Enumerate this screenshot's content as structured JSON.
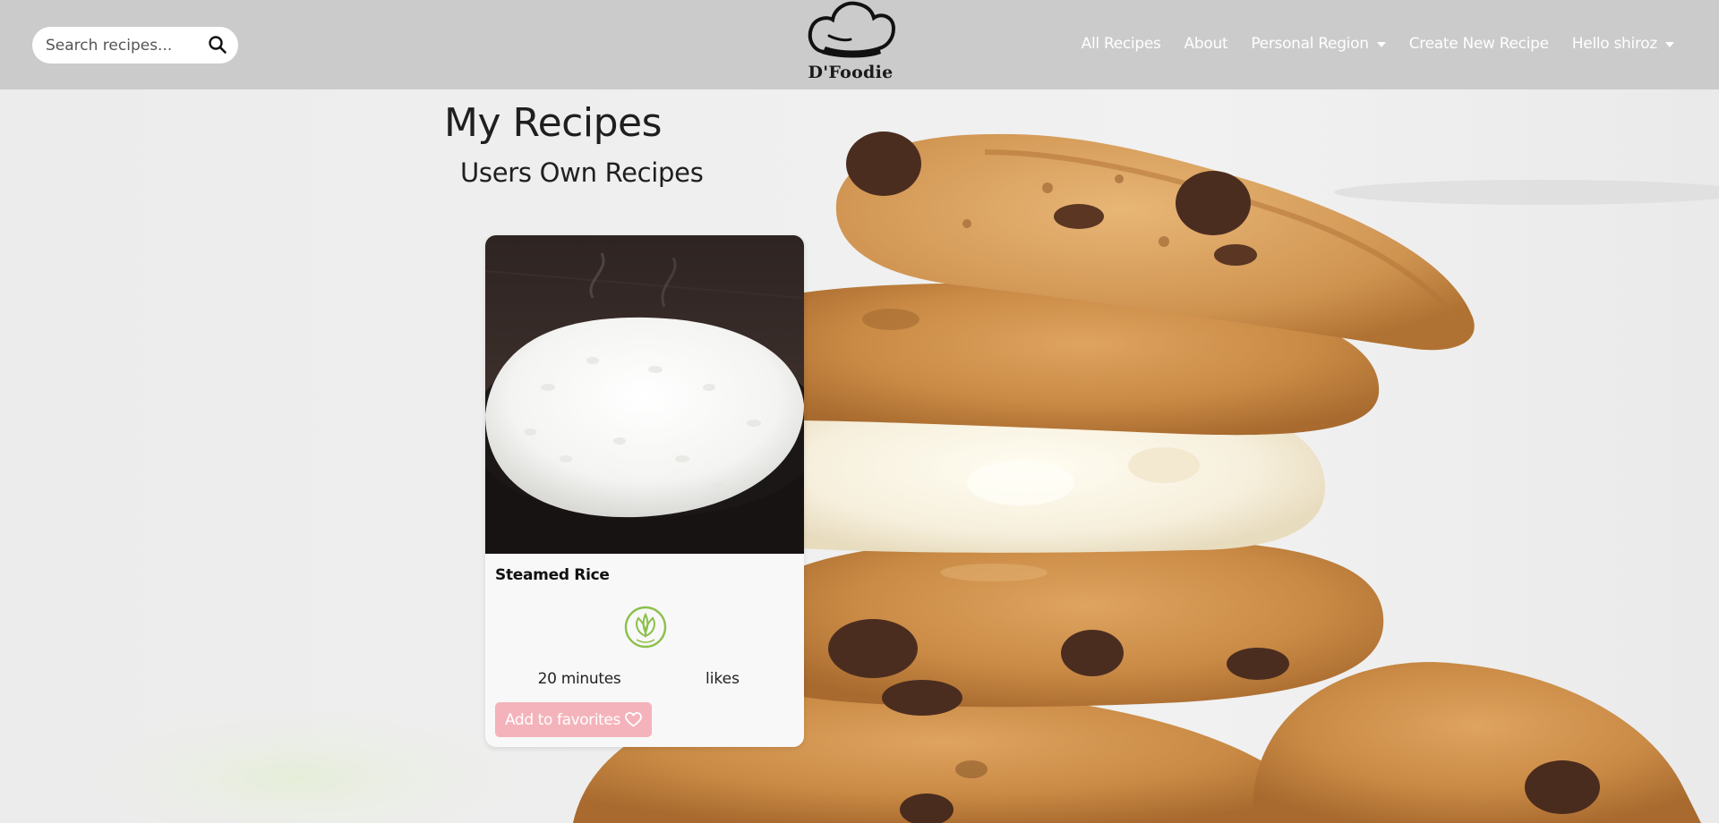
{
  "navbar": {
    "search": {
      "placeholder": "Search recipes...",
      "icon": "search-icon"
    },
    "logo": {
      "text": "D'Foodie",
      "icon": "chef-hat-icon"
    },
    "links": {
      "all_recipes": "All Recipes",
      "about": "About",
      "personal_region": "Personal Region",
      "create_new_recipe": "Create New Recipe",
      "user_greeting": "Hello shiroz"
    }
  },
  "main": {
    "title": "My Recipes",
    "subtitle": "Users Own Recipes"
  },
  "recipe_card": {
    "name": "Steamed Rice",
    "image": "steamed-rice-bowl",
    "badge": "vegan-icon",
    "time": "20 minutes",
    "likes": "likes",
    "favorite_button": "Add to favorites",
    "favorite_icon": "heart-icon"
  },
  "colors": {
    "navbar_bg": "#c8c8c8",
    "favorite_button": "#f4b3bb",
    "vegan_badge": "#8cc04b",
    "page_bg": "#ededed"
  }
}
